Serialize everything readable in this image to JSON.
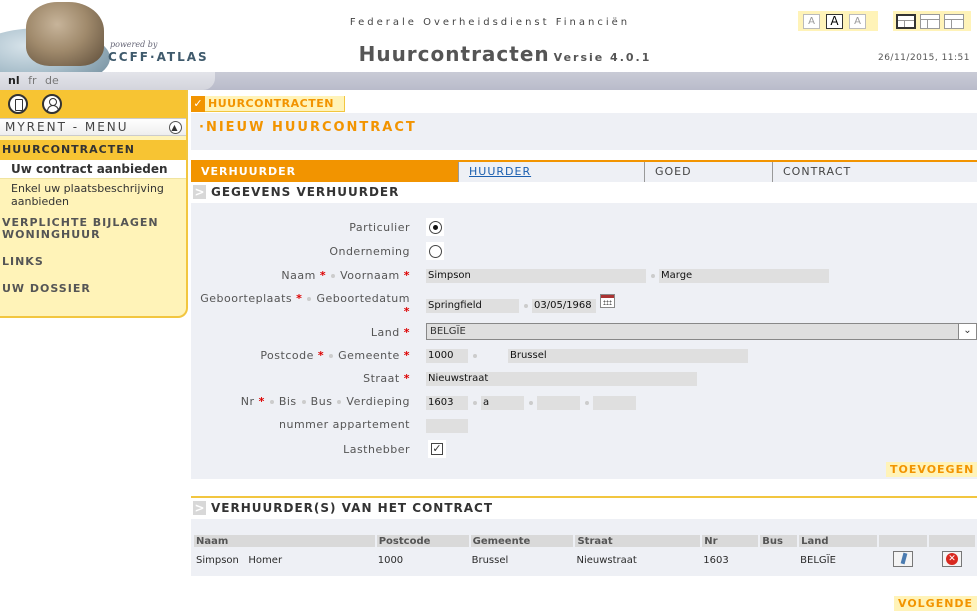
{
  "header": {
    "brand_powered": "powered by",
    "brand_name": "CCFF·ATLAS",
    "agency": "Federale Overheidsdienst Financiën",
    "app_title": "Huurcontracten",
    "app_version": "Versie 4.0.1",
    "timestamp": "26/11/2015, 11:51",
    "font_sizes": [
      "A",
      "A",
      "A"
    ]
  },
  "languages": [
    "nl",
    "fr",
    "de"
  ],
  "sidebar": {
    "menu_title": "MYRENT - MENU",
    "sections": [
      {
        "label": "HUURCONTRACTEN"
      },
      {
        "label": "VERPLICHTE BIJLAGEN WONINGHUUR"
      },
      {
        "label": "LINKS"
      },
      {
        "label": "UW DOSSIER"
      }
    ],
    "sub_items": [
      "Uw contract aanbieden",
      "Enkel uw plaatsbeschrijving aanbieden"
    ]
  },
  "breadcrumb": "HUURCONTRACTEN",
  "page_title": "·NIEUW HUURCONTRACT",
  "tabs": [
    "VERHUURDER",
    "HUURDER",
    "GOED",
    "CONTRACT"
  ],
  "form": {
    "section_title": "GEGEVENS VERHUURDER",
    "labels": {
      "particulier": "Particulier",
      "onderneming": "Onderneming",
      "naam": "Naam",
      "voornaam": "Voornaam",
      "geboorteplaats": "Geboorteplaats",
      "geboortedatum": "Geboortedatum",
      "land": "Land",
      "postcode": "Postcode",
      "gemeente": "Gemeente",
      "straat": "Straat",
      "nr": "Nr",
      "bis": "Bis",
      "bus": "Bus",
      "verdieping": "Verdieping",
      "nummer_appartement": "nummer appartement",
      "lasthebber": "Lasthebber"
    },
    "values": {
      "naam": "Simpson",
      "voornaam": "Marge",
      "geboorteplaats": "Springfield",
      "geboortedatum": "03/05/1968",
      "land": "BELGÏE",
      "postcode": "1000",
      "gemeente": "Brussel",
      "straat": "Nieuwstraat",
      "nr": "1603",
      "bis": "a",
      "bus": "",
      "verdieping": "",
      "nummer_appartement": ""
    },
    "type_selected": "Particulier",
    "lasthebber_checked": true,
    "add_label": "TOEVOEGEN"
  },
  "table": {
    "title": "VERHUURDER(S) VAN HET CONTRACT",
    "headers": [
      "Naam",
      "Postcode",
      "Gemeente",
      "Straat",
      "Nr",
      "Bus",
      "Land",
      "",
      ""
    ],
    "rows": [
      {
        "naam": "Simpson   Homer",
        "postcode": "1000",
        "gemeente": "Brussel",
        "straat": "Nieuwstraat",
        "nr": "1603",
        "bus": "",
        "land": "BELGÏE"
      }
    ]
  },
  "next_label": "VOLGENDE",
  "colors": {
    "accent": "#f29400",
    "menu_bg": "#fff3b8",
    "menu_active": "#f7c433",
    "panel": "#eef0f5"
  }
}
